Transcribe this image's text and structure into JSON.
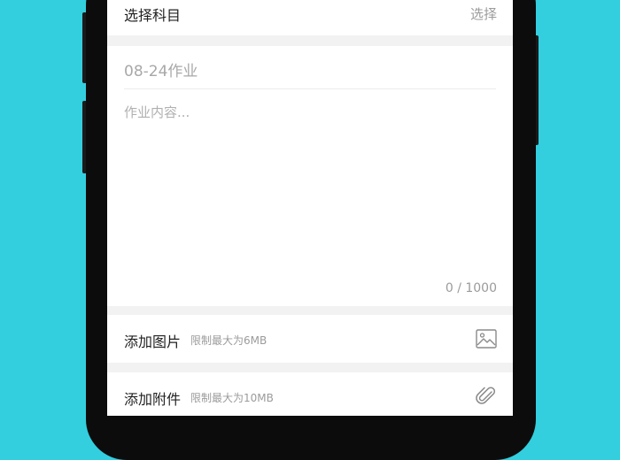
{
  "subject": {
    "label": "选择科目",
    "action": "选择"
  },
  "editor": {
    "title_placeholder": "08-24作业",
    "content_placeholder": "作业内容...",
    "counter": "0 / 1000"
  },
  "attachments": [
    {
      "label": "添加图片",
      "hint": "限制最大为6MB",
      "icon": "image-icon"
    },
    {
      "label": "添加附件",
      "hint": "限制最大为10MB",
      "icon": "paperclip-icon"
    }
  ],
  "colors": {
    "background": "#33CFDF",
    "device": "#0c0c0c",
    "screen": "#f2f2f2",
    "card": "#ffffff",
    "primary_text": "#222222",
    "secondary_text": "#9b9b9b"
  }
}
